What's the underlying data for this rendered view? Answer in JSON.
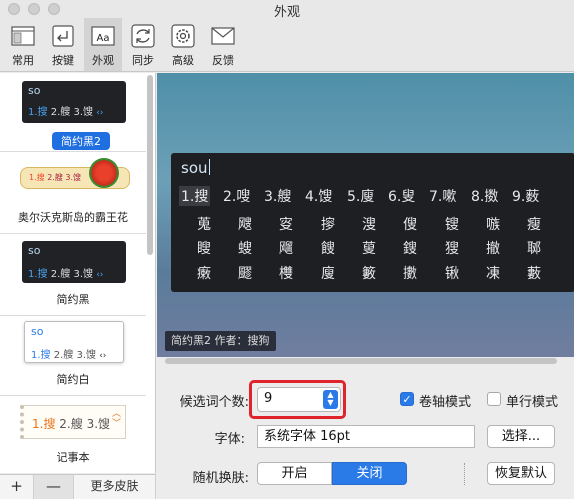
{
  "window": {
    "title": "外观"
  },
  "toolbar": {
    "items": [
      {
        "label": "常用",
        "icon": "window-layout-icon"
      },
      {
        "label": "按键",
        "icon": "keyboard-return-icon"
      },
      {
        "label": "外观",
        "icon": "text-aa-icon",
        "active": true
      },
      {
        "label": "同步",
        "icon": "sync-icon"
      },
      {
        "label": "高级",
        "icon": "gear-icon"
      },
      {
        "label": "反馈",
        "icon": "envelope-icon"
      }
    ]
  },
  "skins": [
    {
      "name": "简约黑2",
      "selected": true,
      "preview_input": "so",
      "preview_cands": [
        "1.搜",
        "2.艘",
        "3.馊"
      ]
    },
    {
      "name": "奥尔沃克斯岛的霸王花",
      "preview_cands": [
        "1.搜",
        "2.艘",
        "3.馊"
      ]
    },
    {
      "name": "简约黑",
      "preview_input": "so",
      "preview_cands": [
        "1.搜",
        "2.艘",
        "3.馊"
      ]
    },
    {
      "name": "简约白",
      "preview_input": "so",
      "preview_cands": [
        "1.搜",
        "2.艘",
        "3.馊"
      ]
    },
    {
      "name": "记事本",
      "preview_cands": [
        "1.搜",
        "2.艘",
        "3.馊"
      ]
    }
  ],
  "sidebar_footer": {
    "add": "+",
    "remove": "—",
    "more": "更多皮肤"
  },
  "preview": {
    "input": "sou",
    "rows": [
      [
        "1.搜",
        "2.嗖",
        "3.艘",
        "4.馊",
        "5.廋",
        "6.叟",
        "7.嗽",
        "8.擞",
        "9.薮"
      ],
      [
        "蒐",
        "飕",
        "叜",
        "摉",
        "溲",
        "傁",
        "锼",
        "嗾",
        "瘦"
      ],
      [
        "瞍",
        "螋",
        "飗",
        "餿",
        "蓃",
        "鎪",
        "獀",
        "撤",
        "郰"
      ],
      [
        "瘷",
        "飂",
        "欆",
        "廋",
        "籔",
        "擻",
        "锹",
        "凍",
        "藪"
      ]
    ],
    "caption": "简约黑2  作者：搜狗"
  },
  "settings": {
    "candidate_count_label": "候选词个数:",
    "candidate_count_value": "9",
    "scroll_mode_label": "卷轴模式",
    "scroll_mode_checked": true,
    "single_line_label": "单行模式",
    "single_line_checked": false,
    "font_label": "字体:",
    "font_value": "系统字体  16pt",
    "font_button": "选择...",
    "random_skin_label": "随机换肤:",
    "random_on": "开启",
    "random_off": "关闭",
    "random_selected": "关闭",
    "restore_button": "恢复默认"
  },
  "colors": {
    "accent": "#2a7be8",
    "highlight": "#e0242c",
    "candidate_bg": "#1d1f23"
  }
}
